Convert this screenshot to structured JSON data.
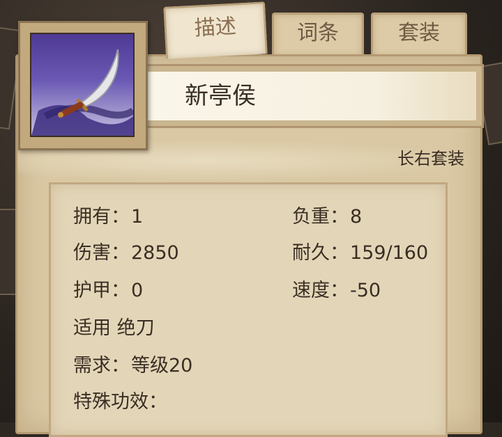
{
  "tabs": [
    {
      "label": "描述",
      "active": true
    },
    {
      "label": "词条",
      "active": false
    },
    {
      "label": "套装",
      "active": false
    }
  ],
  "item": {
    "name": "新亭侯",
    "icon": "curved-blade-icon",
    "set_name": "长右套装"
  },
  "stats": {
    "own": {
      "label": "拥有：",
      "value": "1"
    },
    "weight": {
      "label": "负重：",
      "value": "8"
    },
    "damage": {
      "label": "伤害：",
      "value": "2850"
    },
    "durability": {
      "label": "耐久：",
      "value": "159/160"
    },
    "armor": {
      "label": "护甲：",
      "value": "0"
    },
    "speed": {
      "label": "速度：",
      "value": "-50"
    },
    "applicable": "适用 绝刀",
    "requirement": {
      "label": "需求：",
      "value": "等级20"
    },
    "special_label": "特殊功效："
  },
  "colors": {
    "panel": "#d9c8a3",
    "icon_background": "#5a46a3",
    "text": "#3a2e24"
  }
}
